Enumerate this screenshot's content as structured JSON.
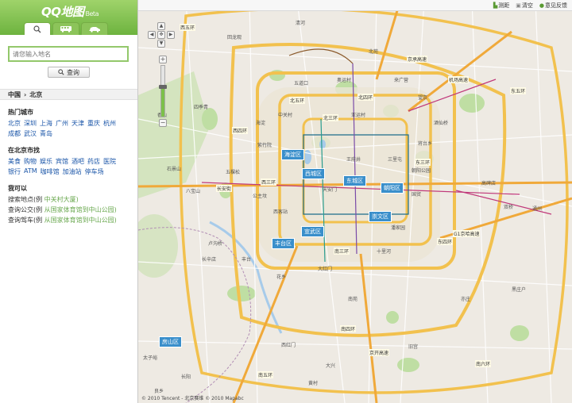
{
  "app": {
    "logo": "QQ地图",
    "beta": "Beta"
  },
  "mode_tabs": [
    {
      "name": "search",
      "icon": "magnifier-icon"
    },
    {
      "name": "bus",
      "icon": "bus-icon"
    },
    {
      "name": "car",
      "icon": "car-icon"
    }
  ],
  "search": {
    "placeholder": "请您输入地名",
    "button_label": "查询"
  },
  "breadcrumb": {
    "country": "中国",
    "separator": "›",
    "city": "北京"
  },
  "hot_cities": {
    "title": "热门城市",
    "items": [
      "北京",
      "深圳",
      "上海",
      "广州",
      "天津",
      "重庆",
      "杭州",
      "成都",
      "武汉",
      "青岛"
    ]
  },
  "nearby": {
    "title": "在北京市找",
    "items": [
      "美食",
      "购物",
      "娱乐",
      "宾馆",
      "酒吧",
      "药店",
      "医院",
      "银行",
      "ATM",
      "咖啡馆",
      "加油站",
      "停车场"
    ]
  },
  "try": {
    "title": "我可以",
    "rows": [
      {
        "label": "搜索地点",
        "prefix": "(例",
        "example": "中关村大厦)"
      },
      {
        "label": "查询公交",
        "prefix": "(例",
        "example": "从国家体育馆到中山公园)"
      },
      {
        "label": "查询驾车",
        "prefix": "(例",
        "example": "从国家体育馆到中山公园)"
      }
    ]
  },
  "toolbar": {
    "items": [
      {
        "icon": "ruler-icon",
        "label": "测距"
      },
      {
        "icon": "clear-icon",
        "label": "清空"
      },
      {
        "icon": "feedback-icon",
        "label": "意见反馈"
      }
    ]
  },
  "map": {
    "zoom_level_fraction": 0.6,
    "copyright": "© 2010 Tencent - 北京赛维  © 2010 Mapabc",
    "districts": [
      "海淀区",
      "西城区",
      "东城区",
      "朝阳区",
      "宣武区",
      "崇文区",
      "丰台区",
      "房山区"
    ],
    "road_labels": [
      "北五环",
      "北四环",
      "北三环",
      "西三环",
      "东三环",
      "东四环",
      "南三环",
      "南四环",
      "南五环",
      "西四环",
      "西五环",
      "东五环",
      "南六环",
      "京开高速",
      "机场高速",
      "京承高速",
      "长安街",
      "G1京哈高速"
    ],
    "places": [
      "清河",
      "回龙观",
      "北苑",
      "来广营",
      "望京",
      "中关村",
      "五道口",
      "奥运村",
      "亚运村",
      "酒仙桥",
      "将台乡",
      "四季青",
      "香山",
      "海淀",
      "紫竹院",
      "三里屯",
      "朝阳公园",
      "国贸",
      "王府井",
      "天安门",
      "石景山",
      "八宝山",
      "五棵松",
      "公主坟",
      "西客站",
      "卢沟桥",
      "丰台",
      "花乡",
      "南苑",
      "亦庄",
      "大红门",
      "潘家园",
      "十里河",
      "高碑店",
      "通州",
      "双桥",
      "黑庄户",
      "旧宫",
      "西红门",
      "大兴",
      "黄村",
      "长辛店",
      "太子峪",
      "长阳",
      "良乡"
    ]
  }
}
